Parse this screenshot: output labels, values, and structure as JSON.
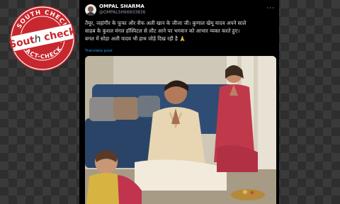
{
  "logo": {
    "top_arc": "SOUTH CHECK",
    "bottom_arc": "FACT-CHECK",
    "wordmark": "South Check"
  },
  "tweet": {
    "author_name": "OMPAL SHARMA",
    "author_handle": "@OMPALSH66603836",
    "text_lines": [
      "तैमूर, जहांगीर के फूफा और सैफ अली खान के जीजा जी। कुणाल खेमू यादव अपने साले",
      "साहब के कुशल मंगल हॉस्पिटल से लौट आने पर भगवान को आभार व्यक्त करते हुए।",
      "बगल में सोहा अली यादव भी हाथ जोड़े दिख रही है 🙏"
    ],
    "translate_label": "Translate post"
  },
  "colors": {
    "background": "#000000",
    "link": "#1d9bf0",
    "logo_red": "#c7282e"
  }
}
